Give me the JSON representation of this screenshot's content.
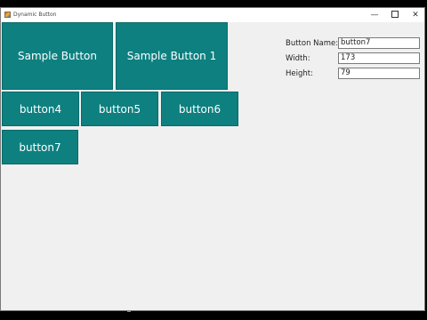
{
  "window": {
    "title": "Dynamic Button",
    "controls": {
      "minimize": "—",
      "close": "✕"
    }
  },
  "buttons": {
    "sample_button": "Sample Button",
    "sample_button_1": "Sample Button 1",
    "button4": "button4",
    "button5": "button5",
    "button6": "button6",
    "button7": "button7"
  },
  "properties": {
    "name_label": "Button Name:",
    "name_value": "button7",
    "width_label": "Width:",
    "width_value": "173",
    "height_label": "Height:",
    "height_value": "79"
  },
  "colors": {
    "button_fill": "#0e8080",
    "background": "#f0f0f0"
  }
}
